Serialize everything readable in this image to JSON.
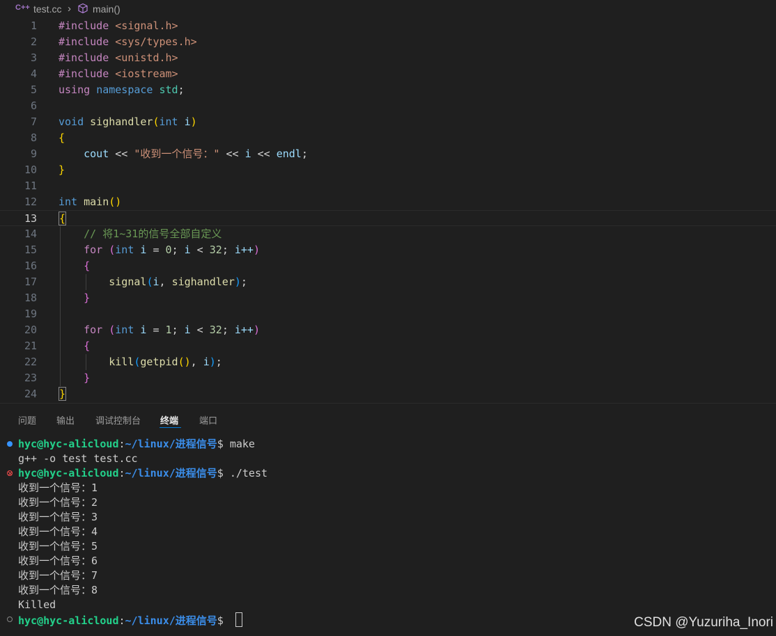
{
  "breadcrumb": {
    "file_icon": "C++",
    "file": "test.cc",
    "separator": "›",
    "symbol_icon": "cube-icon",
    "symbol": "main()"
  },
  "editor": {
    "lines": [
      {
        "n": "1"
      },
      {
        "n": "2"
      },
      {
        "n": "3"
      },
      {
        "n": "4"
      },
      {
        "n": "5"
      },
      {
        "n": "6"
      },
      {
        "n": "7"
      },
      {
        "n": "8"
      },
      {
        "n": "9"
      },
      {
        "n": "10"
      },
      {
        "n": "11"
      },
      {
        "n": "12"
      },
      {
        "n": "13"
      },
      {
        "n": "14"
      },
      {
        "n": "15"
      },
      {
        "n": "16"
      },
      {
        "n": "17"
      },
      {
        "n": "18"
      },
      {
        "n": "19"
      },
      {
        "n": "20"
      },
      {
        "n": "21"
      },
      {
        "n": "22"
      },
      {
        "n": "23"
      },
      {
        "n": "24"
      }
    ],
    "tokens": {
      "include": "#include",
      "h1": "<signal.h>",
      "h2": "<sys/types.h>",
      "h3": "<unistd.h>",
      "h4": "<iostream>",
      "using": "using",
      "namespace": "namespace",
      "std": "std",
      "semi": ";",
      "void": "void",
      "sighandler": "sighandler",
      "lparen": "(",
      "rparen": ")",
      "int": "int",
      "i": "i",
      "lbrace": "{",
      "rbrace": "}",
      "cout": "cout",
      "shl": " << ",
      "msg": "\"收到一个信号：\"",
      "endl": "endl",
      "main": "main",
      "comment": "// 将1~31的信号全部自定义",
      "for": "for",
      "assign": " = ",
      "zero": "0",
      "one": "1",
      "lt": " < ",
      "n32": "32",
      "semi_sp": "; ",
      "incr": "i++",
      "signal": "signal",
      "comma_sp": ", ",
      "kill": "kill",
      "getpid": "getpid",
      "getpid_call": "()"
    }
  },
  "panel": {
    "tabs": [
      "问题",
      "输出",
      "调试控制台",
      "终端",
      "端口"
    ],
    "active_tab": "终端"
  },
  "terminal": {
    "user_host": "hyc@hyc-alicloud",
    "colon": ":",
    "path": "~/linux/进程信号",
    "dollar": "$ ",
    "cmd1": "make",
    "out1": "g++ -o test test.cc",
    "cmd2": "./test",
    "outputs": [
      "收到一个信号：1",
      "收到一个信号：2",
      "收到一个信号：3",
      "收到一个信号：4",
      "收到一个信号：5",
      "收到一个信号：6",
      "收到一个信号：7",
      "收到一个信号：8"
    ],
    "killed": "Killed",
    "status_colors": {
      "success": "#3794ff",
      "error": "#f14c4c",
      "idle": "#858585"
    }
  },
  "watermark": "CSDN @Yuzuriha_Inori"
}
